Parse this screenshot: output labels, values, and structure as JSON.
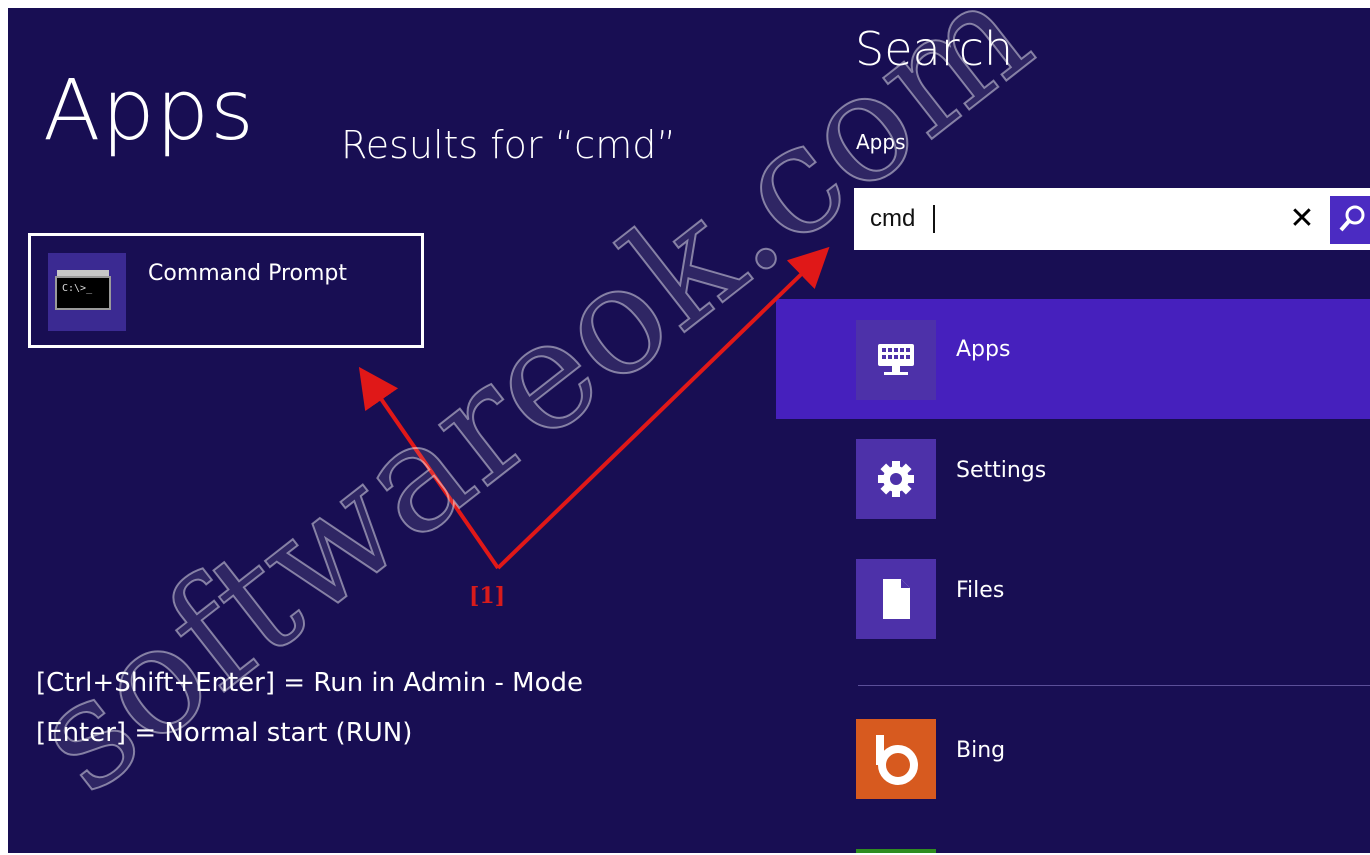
{
  "left_pane": {
    "title": "Apps",
    "results_for": "Results for “cmd”",
    "result": {
      "label": "Command Prompt",
      "icon_text": "C:\\>_",
      "icon": "command-prompt-icon"
    },
    "marker": "[1]",
    "shortcuts": [
      "[Ctrl+Shift+Enter] = Run in Admin - Mode",
      "[Enter] = Normal start (RUN)"
    ]
  },
  "search_pane": {
    "title": "Search",
    "scope": "Apps",
    "query": "cmd",
    "clear_icon": "close-icon",
    "go_icon": "search-icon",
    "categories": [
      {
        "label": "Apps",
        "icon": "keyboard-monitor-icon",
        "selected": true
      },
      {
        "label": "Settings",
        "icon": "gear-icon",
        "selected": false
      },
      {
        "label": "Files",
        "icon": "document-icon",
        "selected": false
      }
    ],
    "apps": [
      {
        "label": "Bing",
        "icon": "bing-icon"
      }
    ]
  },
  "watermark": "softwareok.com",
  "colors": {
    "background": "#180e53",
    "selected_row": "#4620bd",
    "icon_tile": "#4d31a9",
    "arrow": "#e01818",
    "bing": "#d75a1f"
  }
}
